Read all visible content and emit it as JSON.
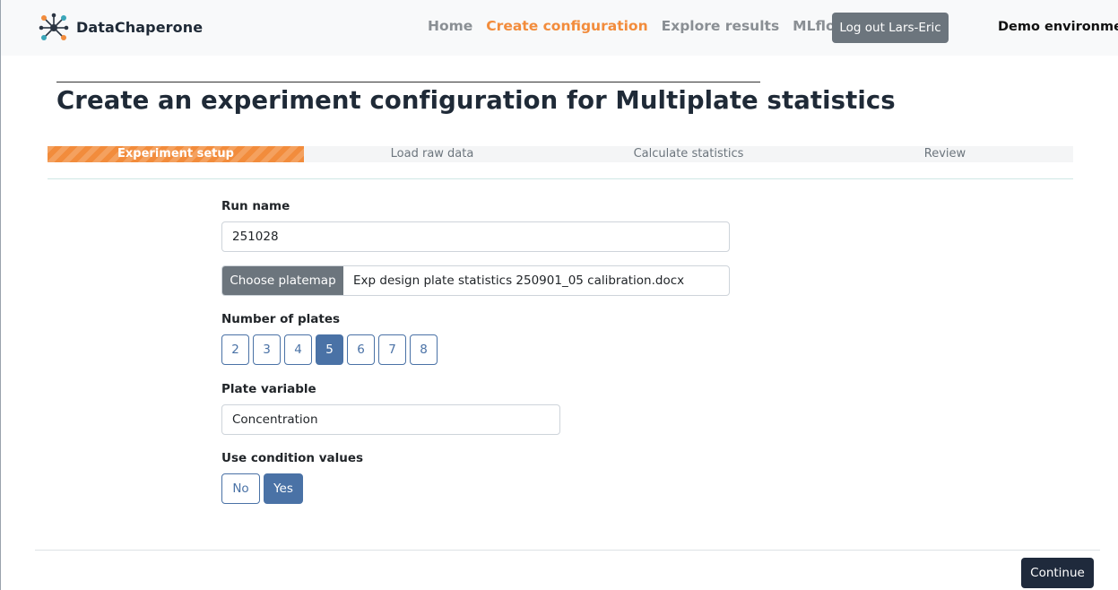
{
  "navbar": {
    "brand": "DataChaperone",
    "links": [
      "Home",
      "Create configuration",
      "Explore results",
      "MLflow"
    ],
    "active_link": "Create configuration",
    "logout_label": "Log out Lars-Eric",
    "environment": "Demo environment"
  },
  "page": {
    "title_prefix": "Create an experiment configuration for ",
    "title_bold": "Multiplate statistics"
  },
  "stepper": {
    "steps": [
      "Experiment setup",
      "Load raw data",
      "Calculate statistics",
      "Review"
    ],
    "active_step": "Experiment setup"
  },
  "form": {
    "run_name": {
      "label": "Run name",
      "value": "251028"
    },
    "platemap": {
      "button_label": "Choose platemap",
      "file_name": "Exp design plate statistics 250901_05 calibration.docx"
    },
    "num_plates": {
      "label": "Number of plates",
      "options": [
        "2",
        "3",
        "4",
        "5",
        "6",
        "7",
        "8"
      ],
      "selected": "5"
    },
    "plate_variable": {
      "label": "Plate variable",
      "value": "Concentration"
    },
    "use_condition_values": {
      "label": "Use condition values",
      "options": [
        "No",
        "Yes"
      ],
      "selected": "Yes"
    }
  },
  "footer": {
    "continue_label": "Continue"
  },
  "colors": {
    "accent_orange": "#f28c3c",
    "primary_blue": "#4a72a6",
    "secondary_gray": "#6c757d",
    "dark_button": "#1f2a3c"
  },
  "icons": {
    "brand_logo": "network-nodes-icon"
  }
}
